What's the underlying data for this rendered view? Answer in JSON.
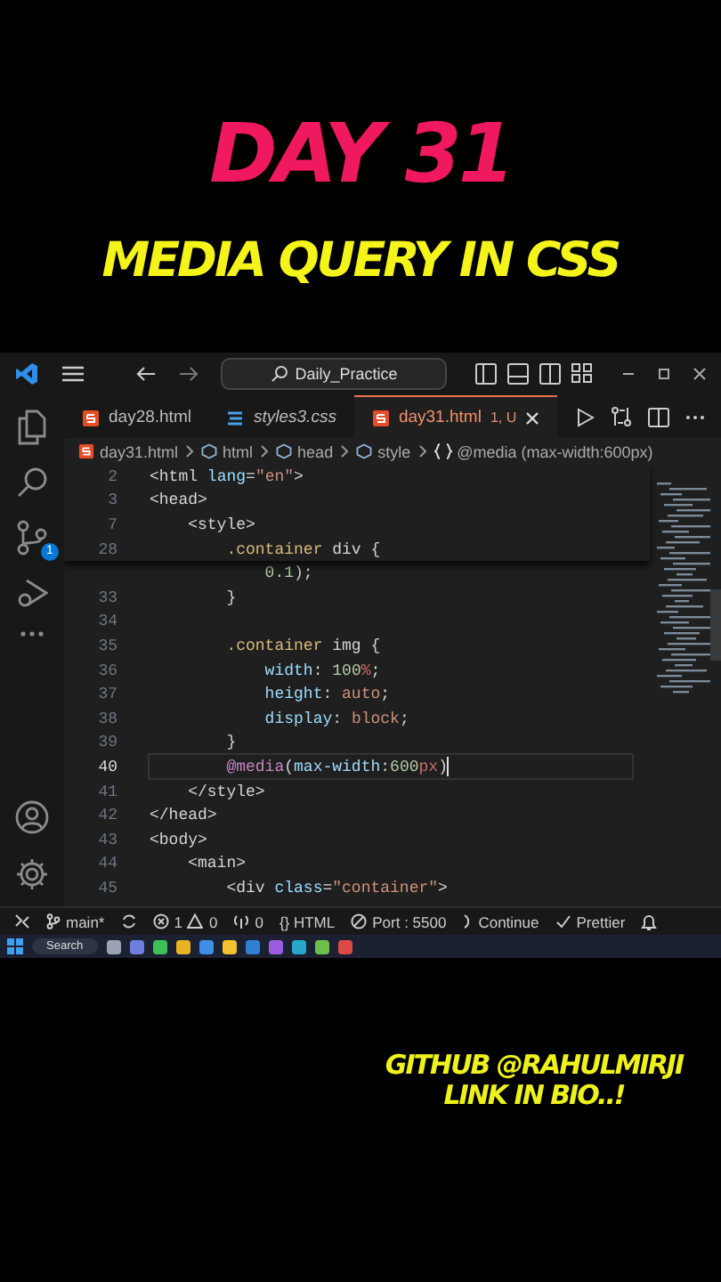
{
  "headline": "DAY 31",
  "subtitle": "MEDIA QUERY IN CSS",
  "editor_window": {
    "title_search": "Daily_Practice",
    "activity_badge": "1",
    "tabs": [
      {
        "label": "day28.html",
        "kind": "html",
        "selected": false,
        "preview": false,
        "has_errors": false
      },
      {
        "label": "styles3.css",
        "kind": "css",
        "selected": false,
        "preview": true,
        "has_errors": false
      },
      {
        "label": "day31.html",
        "kind": "html",
        "selected": true,
        "preview": false,
        "has_errors": true,
        "decoration": "1, U"
      }
    ],
    "breadcrumb": [
      {
        "kind": "file",
        "label": "day31.html"
      },
      {
        "kind": "element",
        "label": "html"
      },
      {
        "kind": "element",
        "label": "head"
      },
      {
        "kind": "element",
        "label": "style"
      },
      {
        "kind": "block",
        "label": "@media (max-width:600px)"
      }
    ],
    "sticky_lines": [
      {
        "number": "2",
        "tokens": [
          {
            "kind": "tag",
            "text": "<html"
          },
          {
            "kind": "attr",
            "text": " lang"
          },
          {
            "kind": "punct",
            "text": "="
          },
          {
            "kind": "string",
            "text": "\"en\""
          },
          {
            "kind": "tag",
            "text": ">"
          }
        ]
      },
      {
        "number": "3",
        "tokens": [
          {
            "kind": "tag",
            "text": "<head>"
          }
        ]
      },
      {
        "number": "7",
        "tokens": [
          {
            "kind": "tag",
            "text": "    <style>"
          }
        ]
      },
      {
        "number": "28",
        "tokens": [
          {
            "kind": "selector",
            "text": "        .container"
          },
          {
            "kind": "tag",
            "text": " div"
          },
          {
            "kind": "punct",
            "text": " {"
          }
        ]
      }
    ],
    "lines": [
      {
        "current": false,
        "tokens": [
          {
            "kind": "num",
            "text": "            0.1"
          },
          {
            "kind": "punct",
            "text": ");"
          }
        ]
      },
      {
        "number": "33",
        "current": false,
        "tokens": [
          {
            "kind": "punct",
            "text": "        }"
          }
        ]
      },
      {
        "number": "34",
        "current": false
      },
      {
        "number": "35",
        "current": false,
        "tokens": [
          {
            "kind": "selector",
            "text": "        .container"
          },
          {
            "kind": "tag",
            "text": " img"
          },
          {
            "kind": "punct",
            "text": " {"
          }
        ]
      },
      {
        "number": "36",
        "current": false,
        "tokens": [
          {
            "kind": "prop",
            "text": "            width"
          },
          {
            "kind": "punct",
            "text": ": "
          },
          {
            "kind": "num",
            "text": "100"
          },
          {
            "kind": "unit",
            "text": "%"
          },
          {
            "kind": "punct",
            "text": ";"
          }
        ]
      },
      {
        "number": "37",
        "current": false,
        "tokens": [
          {
            "kind": "prop",
            "text": "            height"
          },
          {
            "kind": "punct",
            "text": ": "
          },
          {
            "kind": "value",
            "text": "auto"
          },
          {
            "kind": "punct",
            "text": ";"
          }
        ]
      },
      {
        "number": "38",
        "current": false,
        "tokens": [
          {
            "kind": "prop",
            "text": "            display"
          },
          {
            "kind": "punct",
            "text": ": "
          },
          {
            "kind": "value",
            "text": "block"
          },
          {
            "kind": "punct",
            "text": ";"
          }
        ]
      },
      {
        "number": "39",
        "current": false,
        "tokens": [
          {
            "kind": "punct",
            "text": "        }"
          }
        ]
      },
      {
        "number": "40",
        "current": true,
        "tokens": [
          {
            "kind": "at",
            "text": "        @media"
          },
          {
            "kind": "punct",
            "text": "("
          },
          {
            "kind": "prop",
            "text": "max-width"
          },
          {
            "kind": "punct",
            "text": ":"
          },
          {
            "kind": "num",
            "text": "600"
          },
          {
            "kind": "unit",
            "text": "px"
          },
          {
            "kind": "punct",
            "text": ")"
          }
        ]
      },
      {
        "number": "41",
        "current": false,
        "tokens": [
          {
            "kind": "tag",
            "text": "    </style>"
          }
        ]
      },
      {
        "number": "42",
        "current": false,
        "tokens": [
          {
            "kind": "tag",
            "text": "</head>"
          }
        ]
      },
      {
        "number": "43",
        "current": false,
        "tokens": [
          {
            "kind": "tag",
            "text": "<body>"
          }
        ]
      },
      {
        "number": "44",
        "current": false,
        "tokens": [
          {
            "kind": "tag",
            "text": "    <main>"
          }
        ]
      },
      {
        "number": "45",
        "current": false,
        "tokens": [
          {
            "kind": "tag",
            "text": "        <div"
          },
          {
            "kind": "attr",
            "text": " class"
          },
          {
            "kind": "punct",
            "text": "="
          },
          {
            "kind": "string",
            "text": "\"container\""
          },
          {
            "kind": "tag",
            "text": ">"
          }
        ]
      }
    ],
    "status_bar": {
      "branch": "main*",
      "errors": "1",
      "warnings": "0",
      "ports": "0",
      "language": "{} HTML",
      "live_server": "Port : 5500",
      "continue": "Continue",
      "formatter": "Prettier"
    },
    "taskbar": {
      "search": "Search",
      "apps": [
        {
          "color": "#9aa3b5"
        },
        {
          "color": "#6f7fe0"
        },
        {
          "color": "#3cc15a"
        },
        {
          "color": "#e8b324"
        },
        {
          "color": "#3f8fe8"
        },
        {
          "color": "#f2c230"
        },
        {
          "color": "#2f7fd6"
        },
        {
          "color": "#9a5de0"
        },
        {
          "color": "#27a7c9"
        },
        {
          "color": "#6cc04a"
        },
        {
          "color": "#e04848"
        }
      ]
    }
  },
  "footer": [
    "GITHUB @RAHULMIRJI",
    "LINK IN BIO..!"
  ]
}
